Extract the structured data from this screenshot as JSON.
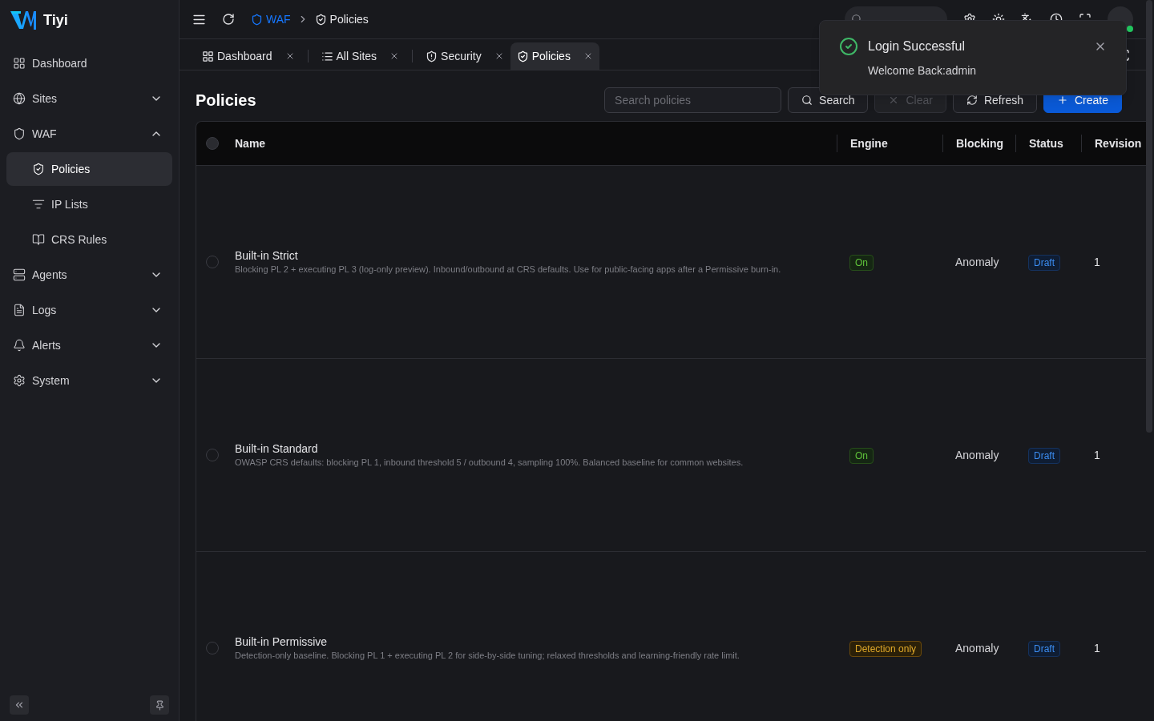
{
  "sidebar": {
    "brand": "Tiyi",
    "items": [
      {
        "label": "Dashboard",
        "selected": false
      },
      {
        "label": "Sites",
        "selected": false,
        "expanded": false
      },
      {
        "label": "WAF",
        "selected": false,
        "expanded": true,
        "children": [
          {
            "label": "Policies",
            "selected": true
          },
          {
            "label": "IP Lists",
            "selected": false
          },
          {
            "label": "CRS Rules",
            "selected": false
          }
        ]
      },
      {
        "label": "Agents",
        "selected": false,
        "expanded": false
      },
      {
        "label": "Logs",
        "selected": false,
        "expanded": false
      },
      {
        "label": "Alerts",
        "selected": false,
        "expanded": false
      },
      {
        "label": "System",
        "selected": false,
        "expanded": false
      }
    ]
  },
  "header": {
    "breadcrumbs": [
      "WAF",
      "Policies"
    ]
  },
  "tabs": [
    {
      "label": "Dashboard",
      "selected": false
    },
    {
      "label": "All Sites",
      "selected": false
    },
    {
      "label": "Security",
      "selected": false
    },
    {
      "label": "Policies",
      "selected": true
    }
  ],
  "page": {
    "title": "Policies",
    "search": {
      "placeholder": "Search policies"
    },
    "buttons": [
      {
        "label": "Search",
        "kind": "search",
        "disabled": false
      },
      {
        "label": "Clear",
        "kind": "clear",
        "disabled": true
      },
      {
        "label": "Refresh",
        "kind": "refresh",
        "disabled": false
      },
      {
        "label": "Create",
        "kind": "create",
        "disabled": false
      }
    ]
  },
  "table": {
    "all_checked": false,
    "columns": [
      "Name",
      "Engine",
      "Blocking",
      "Status",
      "Revision"
    ],
    "rows": [
      {
        "checked": false,
        "name": "Built-in Strict",
        "description": "Blocking PL 2 + executing PL 3 (log-only preview). Inbound/outbound at CRS defaults. Use for public-facing apps after a Permissive burn-in.",
        "engine": {
          "label": "On",
          "kind": "on"
        },
        "blocking": "Anomaly",
        "status": "Draft",
        "revision": "1"
      },
      {
        "checked": false,
        "name": "Built-in Standard",
        "description": "OWASP CRS defaults: blocking PL 1, inbound threshold 5 / outbound 4, sampling 100%. Balanced baseline for common websites.",
        "engine": {
          "label": "On",
          "kind": "on"
        },
        "blocking": "Anomaly",
        "status": "Draft",
        "revision": "1"
      },
      {
        "checked": false,
        "name": "Built-in Permissive",
        "description": "Detection-only baseline. Blocking PL 1 + executing PL 2 for side-by-side tuning; relaxed thresholds and learning-friendly rate limit.",
        "engine": {
          "label": "Detection only",
          "kind": "detection"
        },
        "blocking": "Anomaly",
        "status": "Draft",
        "revision": "1"
      }
    ]
  },
  "toast": {
    "title": "Login Successful",
    "message": "Welcome Back:admin"
  }
}
